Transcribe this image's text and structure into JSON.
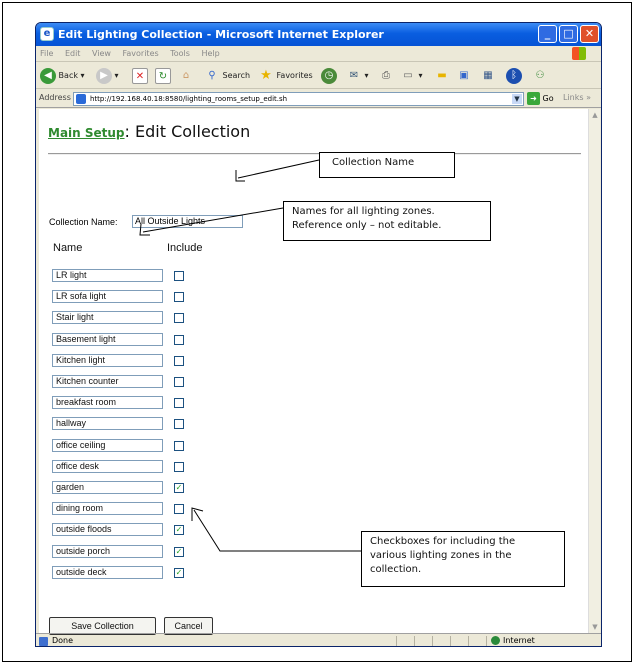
{
  "window": {
    "title": "Edit Lighting Collection - Microsoft Internet Explorer",
    "min": "_",
    "max": "□",
    "close": "✕"
  },
  "menu": [
    "File",
    "Edit",
    "View",
    "Favorites",
    "Tools",
    "Help"
  ],
  "toolbar": {
    "back": "Back",
    "search": "Search",
    "favorites": "Favorites"
  },
  "address": {
    "label": "Address",
    "url": "http://192.168.40.18:8580/lighting_rooms_setup_edit.sh",
    "go": "Go",
    "links": "Links"
  },
  "page": {
    "main_link": "Main Setup",
    "colon": ":",
    "title": "Edit Collection",
    "collection_label": "Collection Name:",
    "collection_value": "All Outside Lights",
    "col_name": "Name",
    "col_include": "Include",
    "zones": [
      {
        "name": "LR light",
        "checked": false
      },
      {
        "name": "LR sofa light",
        "checked": false
      },
      {
        "name": "Stair light",
        "checked": false
      },
      {
        "name": "Basement light",
        "checked": false
      },
      {
        "name": "Kitchen light",
        "checked": false
      },
      {
        "name": "Kitchen counter",
        "checked": false
      },
      {
        "name": "breakfast room",
        "checked": false
      },
      {
        "name": "hallway",
        "checked": false
      },
      {
        "name": "office ceiling",
        "checked": false
      },
      {
        "name": "office desk",
        "checked": false
      },
      {
        "name": "garden",
        "checked": true
      },
      {
        "name": "dining room",
        "checked": false
      },
      {
        "name": "outside floods",
        "checked": true
      },
      {
        "name": "outside porch",
        "checked": true
      },
      {
        "name": "outside deck",
        "checked": true
      }
    ],
    "save_button": "Save Collection",
    "cancel_button": "Cancel"
  },
  "status": {
    "text": "Done",
    "zone": "Internet"
  },
  "callouts": {
    "collection_name": "Collection Name",
    "names_line1": "Names for all lighting zones.",
    "names_line2": "Reference only – not editable.",
    "checkbox_line1": "Checkboxes for including the",
    "checkbox_line2": "various lighting zones in the",
    "checkbox_line3": "collection."
  }
}
